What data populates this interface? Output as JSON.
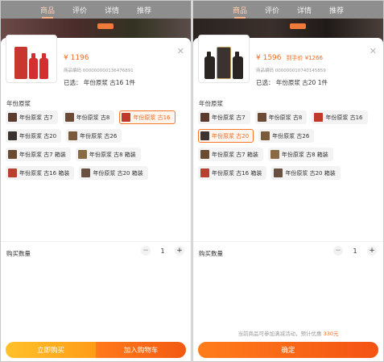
{
  "tabs": [
    "商品",
    "评价",
    "详情",
    "推荐"
  ],
  "left": {
    "price": "¥ 1196",
    "promo": "",
    "code": "商品编码 000000000136476891",
    "selected": "已选：  年份原浆 古16  1件",
    "section_title": "年份原浆",
    "options": [
      "年份原浆 古7",
      "年份原浆 古8",
      "年份原浆 古16",
      "年份原浆 古20",
      "年份原浆 古26",
      "年份原浆 古7 箱装",
      "年份原浆 古8 箱装",
      "年份原浆 古16 箱装",
      "年份原浆 古20 箱装"
    ],
    "selected_index": 2,
    "qty_label": "购买数量",
    "qty_minus": "−",
    "qty_value": "1",
    "qty_plus": "+",
    "buy_label": "立即购买",
    "cart_label": "加入购物车"
  },
  "right": {
    "price": "¥ 1596",
    "promo": "到手价 ¥1266",
    "code": "商品编码 000000010740145859",
    "selected": "已选：  年份原浆 古20  1件",
    "section_title": "年份原浆",
    "options": [
      "年份原浆 古7",
      "年份原浆 古8",
      "年份原浆 古16",
      "年份原浆 古20",
      "年份原浆 古26",
      "年份原浆 古7 箱装",
      "年份原浆 古8 箱装",
      "年份原浆 古16 箱装",
      "年份原浆 古20 箱装"
    ],
    "selected_index": 3,
    "qty_label": "购买数量",
    "qty_minus": "−",
    "qty_value": "1",
    "qty_plus": "+",
    "notice_prefix": "当前商品可参加满减活动，预计优惠 ",
    "notice_amount": "330元",
    "confirm_label": "确定"
  },
  "colors": {
    "accent": "#f06a1e",
    "selected_border": "#f4772a"
  },
  "icons": {
    "close": "close-icon",
    "option": "product-thumbnail-icon"
  }
}
